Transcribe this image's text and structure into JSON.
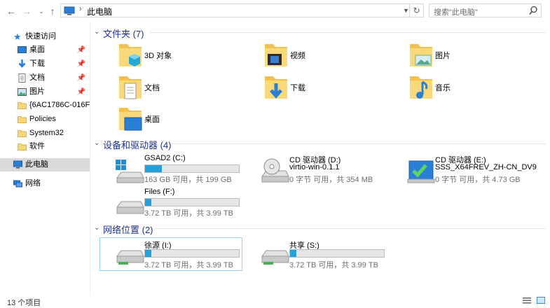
{
  "address": {
    "crumb": "此电脑",
    "search_placeholder": "搜索\"此电脑\""
  },
  "nav": {
    "quick_access": "快速访问",
    "items": [
      {
        "label": "桌面",
        "pinned": true
      },
      {
        "label": "下载",
        "pinned": true
      },
      {
        "label": "文档",
        "pinned": true
      },
      {
        "label": "图片",
        "pinned": true
      },
      {
        "label": "{6AC1786C-016F-",
        "pinned": false
      },
      {
        "label": "Policies",
        "pinned": false
      },
      {
        "label": "System32",
        "pinned": false
      },
      {
        "label": "软件",
        "pinned": false
      }
    ],
    "this_pc": "此电脑",
    "network": "网络"
  },
  "sections": {
    "folders": "文件夹 (7)",
    "drives": "设备和驱动器 (4)",
    "network": "网络位置 (2)"
  },
  "folders": [
    {
      "label": "3D 对象"
    },
    {
      "label": "视频"
    },
    {
      "label": "图片"
    },
    {
      "label": "文档"
    },
    {
      "label": "下载"
    },
    {
      "label": "音乐"
    },
    {
      "label": "桌面"
    }
  ],
  "drives": [
    {
      "name": "GSAD2 (C:)",
      "info": "163 GB 可用，共 199 GB",
      "used_fraction": 0.18
    },
    {
      "name": "CD 驱动器 (D:)",
      "sub": "virtio-win-0.1.1",
      "info": "0 字节 可用，共 354 MB"
    },
    {
      "name": "CD 驱动器 (E:)",
      "sub": "SSS_X64FREV_ZH-CN_DV9",
      "info": "0 字节 可用，共 4.73 GB"
    },
    {
      "name": "Files (F:)",
      "info": "3.72 TB 可用，共 3.99 TB",
      "used_fraction": 0.07
    }
  ],
  "network_drives": [
    {
      "name": "徐源 (I:)",
      "info": "3.72 TB 可用，共 3.99 TB",
      "used_fraction": 0.07
    },
    {
      "name": "共享 (S:)",
      "info": "3.72 TB 可用，共 3.99 TB",
      "used_fraction": 0.07
    }
  ],
  "status": {
    "count": "13 个项目"
  },
  "colors": {
    "accent": "#26a0da",
    "section": "#1e3287",
    "selection": "#d9d9d9"
  }
}
